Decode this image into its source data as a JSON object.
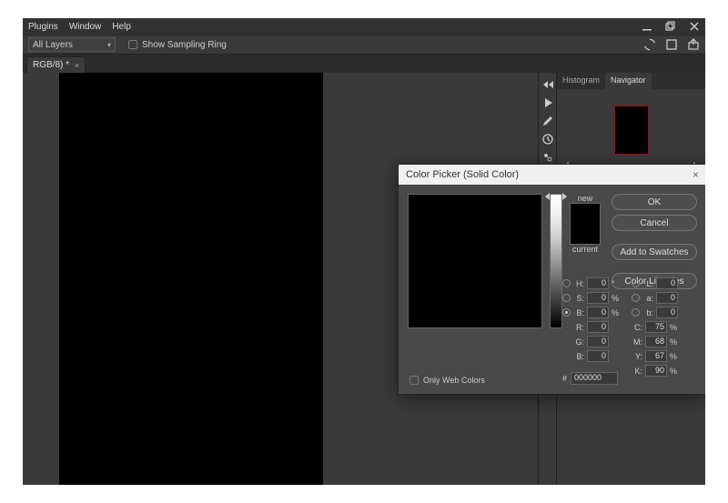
{
  "menubar": {
    "items": [
      "Plugins",
      "Window",
      "Help"
    ]
  },
  "optbar": {
    "sample_label": "All Layers",
    "ring_label": "Show Sampling Ring"
  },
  "tabs": {
    "doc": "RGB/8) *"
  },
  "panels": {
    "tabs": [
      "Histogram",
      "Navigator"
    ],
    "active": 1
  },
  "dialog": {
    "title": "Color Picker (Solid Color)",
    "new_label": "new",
    "current_label": "current",
    "ok": "OK",
    "cancel": "Cancel",
    "add_swatches": "Add to Swatches",
    "libraries": "Color Libraries",
    "webonly": "Only Web Colors",
    "fields": {
      "H": "0",
      "S": "0",
      "B": "0",
      "L": "0",
      "a": "0",
      "b": "0",
      "R": "0",
      "G": "0",
      "Bc": "0",
      "C": "75",
      "M": "68",
      "Y": "67",
      "K": "90"
    },
    "hex_label": "#",
    "hex": "000000",
    "deg": "°",
    "pct": "%"
  }
}
